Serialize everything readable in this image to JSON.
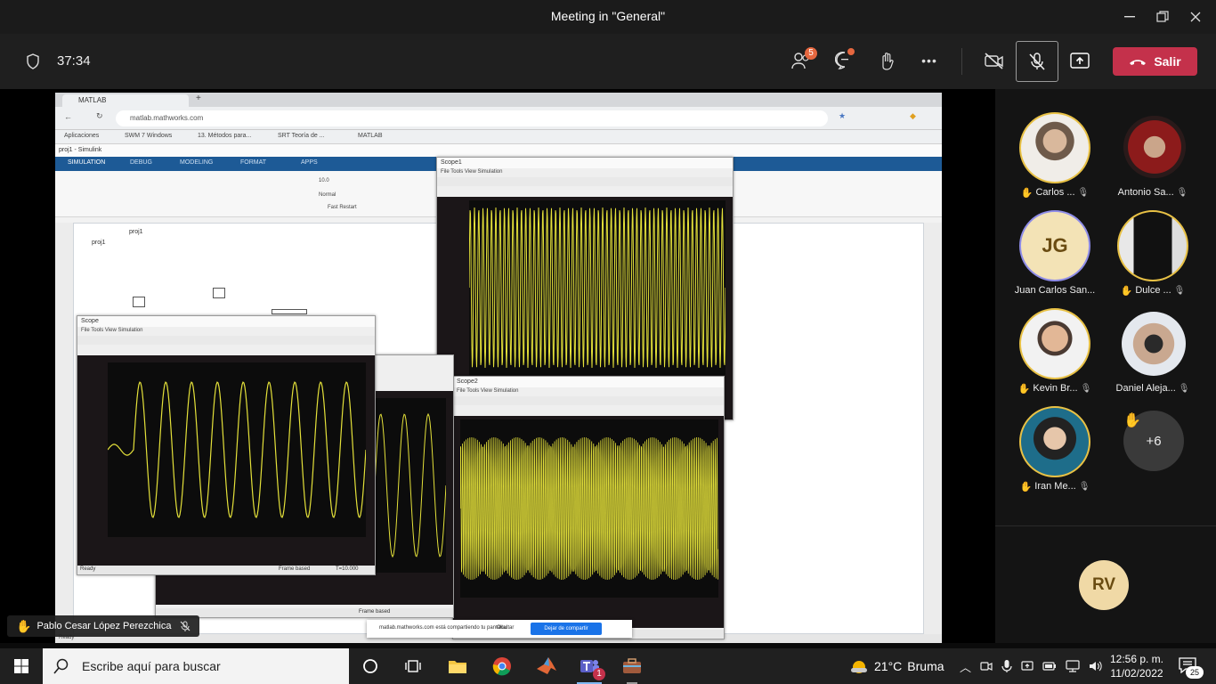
{
  "window": {
    "title": "Meeting in \"General\"",
    "minimize": "—",
    "maximize": "❐",
    "close": "✕"
  },
  "meeting": {
    "timer": "37:34",
    "participants_badge": "5",
    "leave_label": "Salir",
    "more_label": "•••"
  },
  "shared_screen": {
    "browser_tab": "MATLAB",
    "url": "matlab.mathworks.com",
    "bookmarks": [
      "Aplicaciones",
      "SWM 7 Windows",
      "13. Métodos para...",
      "SRT Teoría de ...",
      "MATLAB"
    ],
    "simulink_title": "proj1 - Simulink",
    "ribbon_tabs": [
      "SIMULATION",
      "DEBUG",
      "MODELING",
      "FORMAT",
      "APPS"
    ],
    "model_name": "proj1",
    "stop_time": "10.0",
    "mode": "Normal",
    "fast_restart": "Fast Restart",
    "scope1_title": "Scope",
    "scope2_title": "Scope1",
    "scope3_title": "Scope2",
    "scope_menu": "File  Tools  View  Simulation",
    "status_ready": "Ready",
    "frame_based": "Frame based",
    "time_offset": "T=10.000",
    "popup_text": "matlab.mathworks.com está compartiendo tu pantalla.",
    "popup_stop": "Dejar de compartir",
    "popup_hide": "Ocultar",
    "presenter_name": "Pablo Cesar López Perezchica"
  },
  "participants": [
    {
      "name": "Carlos ...",
      "initials": "",
      "hand": true,
      "muted": true,
      "ring": true
    },
    {
      "name": "Antonio Sa...",
      "initials": "",
      "hand": false,
      "muted": true,
      "ring": false
    },
    {
      "name": "Juan Carlos San...",
      "initials": "JG",
      "hand": false,
      "muted": false,
      "ring": true
    },
    {
      "name": "Dulce ...",
      "initials": "",
      "hand": true,
      "muted": true,
      "ring": true
    },
    {
      "name": "Kevin Br...",
      "initials": "",
      "hand": true,
      "muted": true,
      "ring": true
    },
    {
      "name": "Daniel Aleja...",
      "initials": "",
      "hand": false,
      "muted": true,
      "ring": false
    },
    {
      "name": "Iran Me...",
      "initials": "",
      "hand": true,
      "muted": true,
      "ring": true
    }
  ],
  "overflow_count": "+6",
  "self_initials": "RV",
  "taskbar": {
    "search_placeholder": "Escribe aquí para buscar",
    "weather_temp": "21°C",
    "weather_desc": "Bruma",
    "time": "12:56 p. m.",
    "date": "11/02/2022",
    "notification_count": "25",
    "teams_badge": "1"
  },
  "colors": {
    "leave_red": "#c4314b",
    "raised_hand": "#e8c145",
    "badge_orange": "#e5673f",
    "scope_trace": "#e4e13a"
  }
}
